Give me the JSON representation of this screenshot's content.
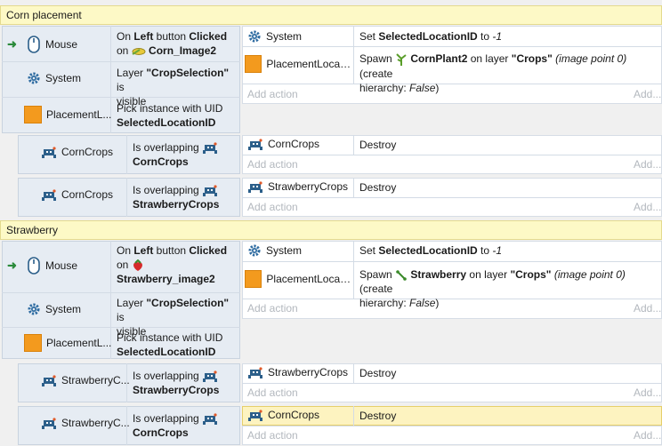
{
  "groups": [
    {
      "title": "Corn placement",
      "event": {
        "conditions": [
          {
            "object": "Mouse",
            "icon": "mouse-icon",
            "pre": "On ",
            "bold1": "Left",
            "mid": " button ",
            "bold2": "Clicked",
            "pre2": "on ",
            "target": "Corn_Image2",
            "target_icon": "corn-image-icon"
          },
          {
            "object": "System",
            "icon": "gear-icon",
            "text1": "Layer ",
            "bold": "\"CropSelection\"",
            "text2": " is",
            "line2": "visible"
          },
          {
            "object": "PlacementL...",
            "icon": "placement-sprite-icon",
            "line1": "Pick instance with UID",
            "bold": "SelectedLocationID"
          }
        ],
        "actions": [
          {
            "object": "System",
            "icon": "gear-icon",
            "pre": "Set ",
            "bold": "SelectedLocationID",
            "mid": " to ",
            "italic": "-1"
          },
          {
            "object": "PlacementLocati...",
            "icon": "placement-sprite-icon",
            "pre": "Spawn ",
            "target": "CornPlant2",
            "target_icon": "corn-plant-icon",
            "mid": " on layer ",
            "bold": "\"Crops\"",
            "italic": "(image point 0)",
            "tail": " (create",
            "line2a": "hierarchy: ",
            "line2b": "False",
            "line2c": ")"
          }
        ],
        "add_action": "Add action",
        "add_short": "Add..."
      },
      "subevents": [
        {
          "object": "CornCrops",
          "cond_pre": "Is overlapping",
          "cond_target": "CornCrops",
          "act_object": "CornCrops",
          "act": "Destroy",
          "add_action": "Add action",
          "add_short": "Add..."
        },
        {
          "object": "CornCrops",
          "cond_pre": "Is overlapping",
          "cond_target": "StrawberryCrops",
          "act_object": "StrawberryCrops",
          "act": "Destroy",
          "add_action": "Add action",
          "add_short": "Add..."
        }
      ]
    },
    {
      "title": "Strawberry",
      "event": {
        "conditions": [
          {
            "object": "Mouse",
            "icon": "mouse-icon",
            "pre": "On ",
            "bold1": "Left",
            "mid": " button ",
            "bold2": "Clicked",
            "pre2": "on ",
            "target": "Strawberry_image2",
            "target_icon": "strawberry-icon"
          },
          {
            "object": "System",
            "icon": "gear-icon",
            "text1": "Layer ",
            "bold": "\"CropSelection\"",
            "text2": " is",
            "line2": "visible"
          },
          {
            "object": "PlacementL...",
            "icon": "placement-sprite-icon",
            "line1": "Pick instance with UID",
            "bold": "SelectedLocationID"
          }
        ],
        "actions": [
          {
            "object": "System",
            "icon": "gear-icon",
            "pre": "Set ",
            "bold": "SelectedLocationID",
            "mid": " to ",
            "italic": "-1"
          },
          {
            "object": "PlacementLocati...",
            "icon": "placement-sprite-icon",
            "pre": "Spawn ",
            "target": "Strawberry",
            "target_icon": "strawberry-plant-icon",
            "mid": " on layer ",
            "bold": "\"Crops\"",
            "italic": "(image point 0)",
            "tail": " (create",
            "line2a": "hierarchy: ",
            "line2b": "False",
            "line2c": ")"
          }
        ],
        "add_action": "Add action",
        "add_short": "Add..."
      },
      "subevents": [
        {
          "object": "StrawberryC...",
          "cond_pre": "Is overlapping",
          "cond_target": "StrawberryCrops",
          "act_object": "StrawberryCrops",
          "act": "Destroy",
          "add_action": "Add action",
          "add_short": "Add..."
        },
        {
          "object": "StrawberryC...",
          "cond_pre": "Is overlapping",
          "cond_target": "CornCrops",
          "act_object": "CornCrops",
          "act": "Destroy",
          "add_action": "Add action",
          "add_short": "Add...",
          "selected": true
        }
      ]
    }
  ],
  "colors": {
    "group_header": "#fdf9c6",
    "condition_bg": "#e6ecf3",
    "action_bg": "#ffffff",
    "selected_action": "#fdf3c0",
    "placement_sprite": "#f39a1e",
    "trigger_arrow": "#2a8a3a"
  }
}
